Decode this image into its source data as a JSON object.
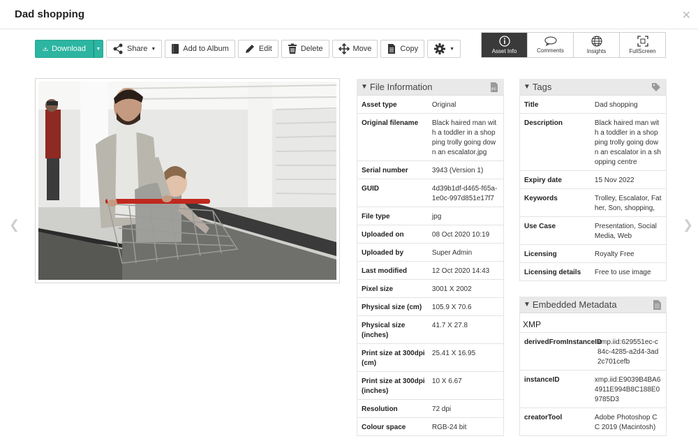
{
  "window": {
    "title": "Dad shopping"
  },
  "toolbar": {
    "download": "Download",
    "share": "Share",
    "add_to_album": "Add to Album",
    "edit": "Edit",
    "delete": "Delete",
    "move": "Move",
    "copy": "Copy"
  },
  "view_tabs": {
    "asset_info": "Asset Info",
    "comments": "Comments",
    "insights": "Insights",
    "fullscreen": "FullScreen"
  },
  "colors": {
    "accent": "#2cb5a1",
    "active_tab": "#3a3a3a"
  },
  "file_info": {
    "title": "File Information",
    "rows": [
      {
        "k": "Asset type",
        "v": "Original",
        "h": 26
      },
      {
        "k": "Original filename",
        "v": "Black haired man with a toddler in a shopping trolly going down an escalator.jpg",
        "h": 68
      },
      {
        "k": "Serial number",
        "v": "3943 (Version 1)",
        "h": 26
      },
      {
        "k": "GUID",
        "v": "4d39b1df-d465-f65a-1e0c-997d851e17f7",
        "h": 40
      },
      {
        "k": "File type",
        "v": "jpg",
        "h": 26
      },
      {
        "k": "Uploaded on",
        "v": "08 Oct 2020 10:19",
        "h": 26
      },
      {
        "k": "Uploaded by",
        "v": "Super Admin",
        "h": 26
      },
      {
        "k": "Last modified",
        "v": "12 Oct 2020 14:43",
        "h": 26
      },
      {
        "k": "Pixel size",
        "v": "3001 X 2002",
        "h": 26
      },
      {
        "k": "Physical size (cm)",
        "v": "105.9 X 70.6",
        "h": 26
      },
      {
        "k": "Physical size (inches)",
        "v": "41.7 X 27.8",
        "h": 40
      },
      {
        "k": "Print size at 300dpi (cm)",
        "v": "25.41 X 16.95",
        "h": 40
      },
      {
        "k": "Print size at 300dpi (inches)",
        "v": "10 X 6.67",
        "h": 40
      },
      {
        "k": "Resolution",
        "v": "72 dpi",
        "h": 26
      },
      {
        "k": "Colour space",
        "v": "RGB-24 bit",
        "h": 26
      }
    ]
  },
  "tags": {
    "title": "Tags",
    "rows": [
      {
        "k": "Title",
        "v": "Dad shopping",
        "h": 26
      },
      {
        "k": "Description",
        "v": "Black haired man with a toddler in a shopping trolly going down an escalator in a shopping centre",
        "h": 82
      },
      {
        "k": "Expiry date",
        "v": "15 Nov 2022",
        "h": 26
      },
      {
        "k": "Keywords",
        "v": "Trolley, Escalator, Father, Son, shopping,",
        "h": 40
      },
      {
        "k": "Use Case",
        "v": "Presentation, Social Media, Web",
        "h": 40
      },
      {
        "k": "Licensing",
        "v": "Royalty Free",
        "h": 26
      },
      {
        "k": "Licensing details",
        "v": "Free to use image",
        "h": 26
      }
    ]
  },
  "embedded": {
    "title": "Embedded Metadata",
    "sub": "XMP",
    "rows": [
      {
        "k": "derivedFromInstanceID",
        "v": "xmp.iid:629551ec-c84c-4285-a2d4-3ad2c701cefb",
        "h": 54
      },
      {
        "k": "instanceID",
        "v": "xmp.iid:E9039B4BA64911E994B8C188E09785D3",
        "h": 54
      },
      {
        "k": "creatorTool",
        "v": "Adobe Photoshop CC 2019 (Macintosh)",
        "h": 40
      }
    ]
  }
}
